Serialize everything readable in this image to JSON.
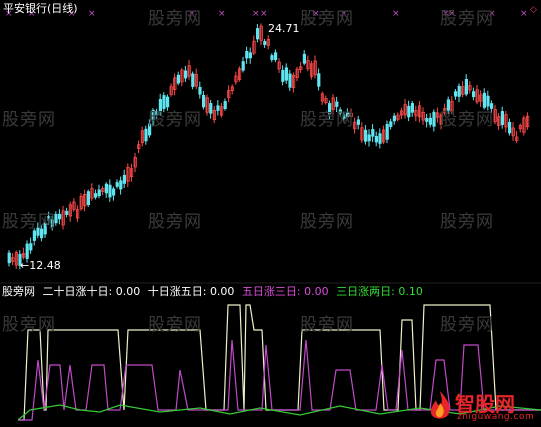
{
  "title": "平安银行(日线)",
  "watermark": "股旁网",
  "price_high_label": "24.71",
  "price_low_label": "←12.48",
  "indicator": {
    "name": "股旁网",
    "items": [
      {
        "label": "二十日涨十日:",
        "value": "0.00",
        "color": "#ffffff"
      },
      {
        "label": "十日涨五日:",
        "value": "0.00",
        "color": "#ffffff"
      },
      {
        "label": "五日涨三日:",
        "value": "0.00",
        "color": "#d94cd9"
      },
      {
        "label": "三日涨两日:",
        "value": "0.10",
        "color": "#33dd33"
      }
    ]
  },
  "logo": {
    "text": "智股网",
    "sub": "zhiguwang.com"
  },
  "colors": {
    "up": "#ff4a4a",
    "down": "#5fe6f0",
    "white_line": "#f0f0c8",
    "magenta": "#c04ac8",
    "green": "#33cc33",
    "marker": "#c050c0"
  }
}
